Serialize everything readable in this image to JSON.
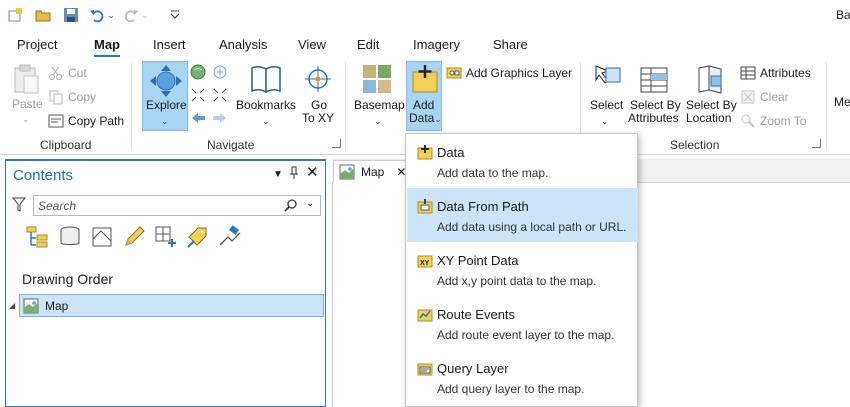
{
  "window": {
    "title": "Ba"
  },
  "tabs": [
    "Project",
    "Map",
    "Insert",
    "Analysis",
    "View",
    "Edit",
    "Imagery",
    "Share"
  ],
  "active_tab": "Map",
  "ribbon": {
    "clipboard": {
      "paste": "Paste",
      "cut": "Cut",
      "copy": "Copy",
      "copy_path": "Copy Path",
      "label": "Clipboard"
    },
    "navigate": {
      "explore": "Explore",
      "bookmarks": "Bookmarks",
      "goto_line1": "Go",
      "goto_line2": "To XY",
      "label": "Navigate"
    },
    "layer": {
      "basemap": "Basemap",
      "add_data_line1": "Add",
      "add_data_line2": "Data",
      "add_graphics": "Add Graphics Layer"
    },
    "selection": {
      "select": "Select",
      "select_by_attr_line1": "Select By",
      "select_by_attr_line2": "Attributes",
      "select_by_loc_line1": "Select By",
      "select_by_loc_line2": "Location",
      "attributes": "Attributes",
      "clear": "Clear",
      "zoom_to": "Zoom To",
      "label": "Selection"
    },
    "overflow_label": "Me"
  },
  "contents": {
    "title": "Contents",
    "search_placeholder": "Search",
    "drawing_order": "Drawing Order",
    "map_item": "Map"
  },
  "view_tab": {
    "label": "Map"
  },
  "add_data_menu": [
    {
      "title": "Data",
      "desc": "Add data to the map."
    },
    {
      "title": "Data From Path",
      "desc": "Add data using a local path or URL."
    },
    {
      "title": "XY Point Data",
      "desc": "Add x,y point data to the map."
    },
    {
      "title": "Route Events",
      "desc": "Add route event layer to the map."
    },
    {
      "title": "Query Layer",
      "desc": "Add query layer to the map."
    }
  ],
  "colors": {
    "accent": "#2479c4",
    "highlight": "#cce4f7",
    "pressed": "#a9d5f5"
  }
}
